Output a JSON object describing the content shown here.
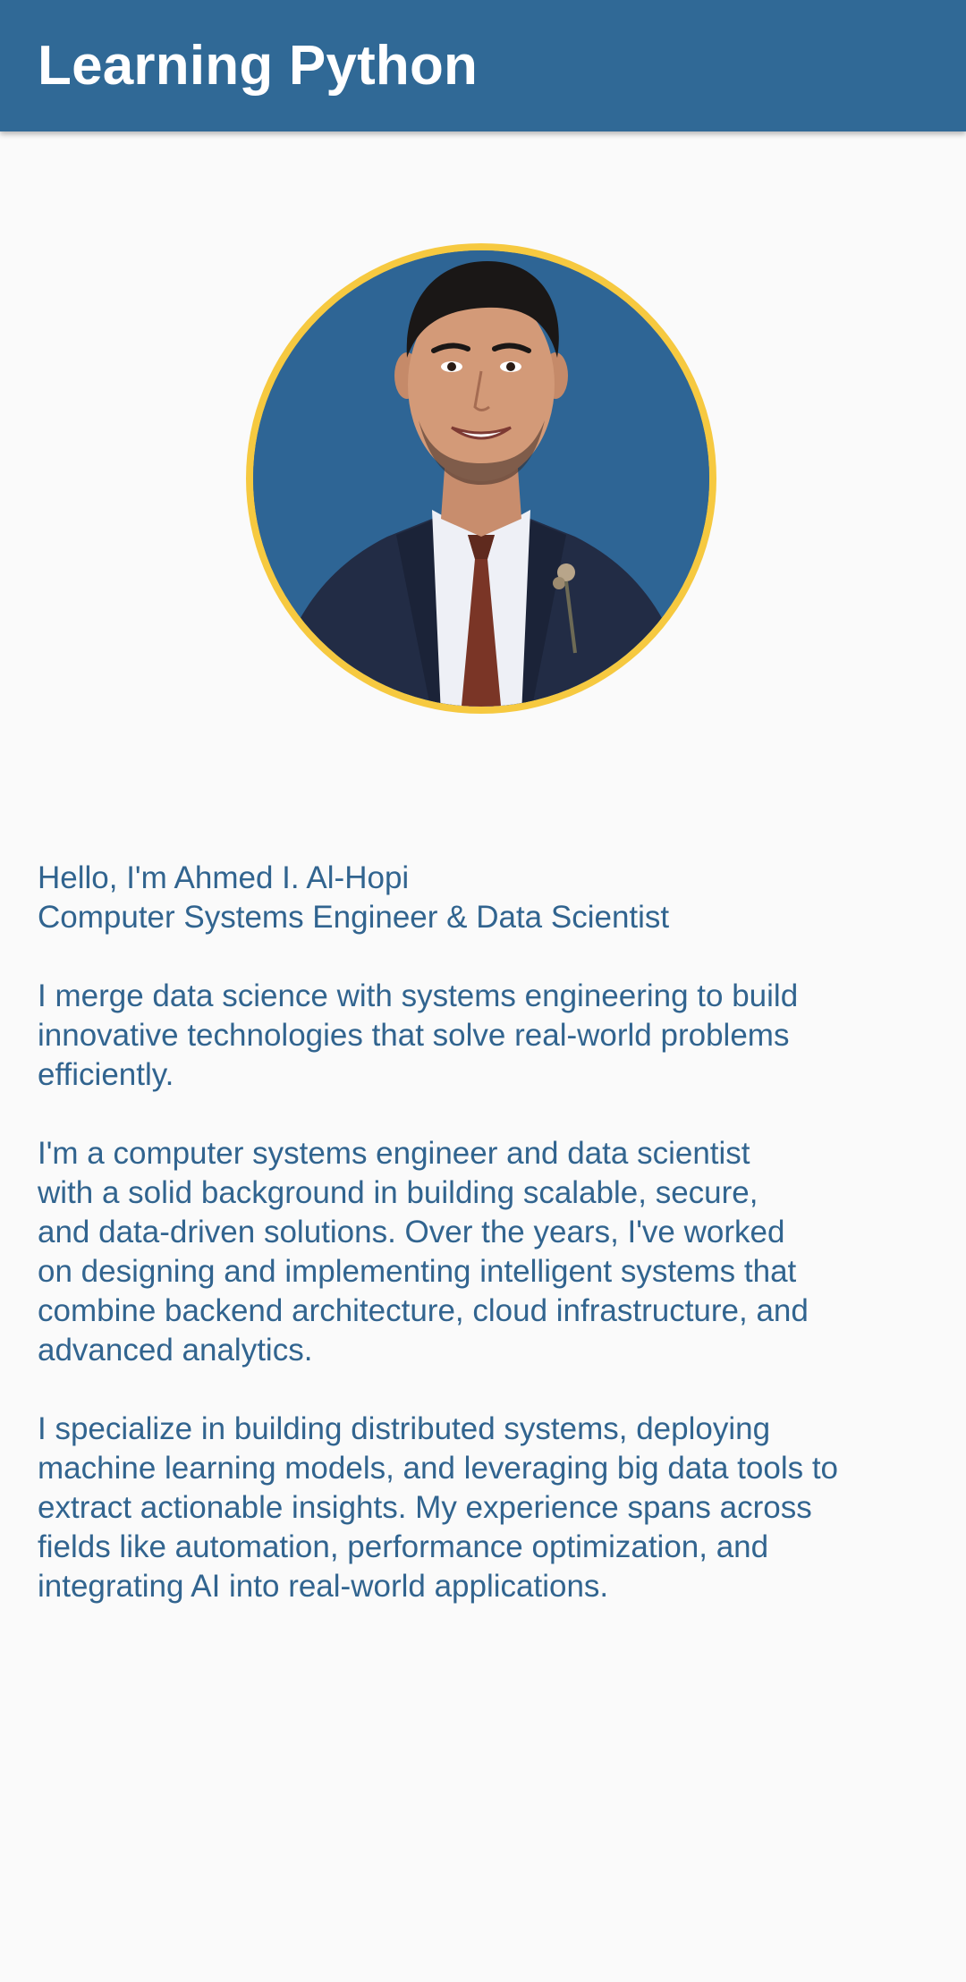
{
  "app_bar": {
    "title": "Learning Python"
  },
  "profile": {
    "avatar": "profile-photo",
    "colors": {
      "app_bar": "#306996",
      "avatar_ring": "#f6c940",
      "avatar_background": "#2e6595",
      "text": "#31648f",
      "page_background": "#fafafa"
    }
  },
  "about": {
    "greeting": "Hello, I'm Ahmed I. Al-Hopi",
    "role": "Computer Systems Engineer & Data Scientist",
    "paragraph_1": "I merge data science with systems engineering to build\ninnovative technologies that solve real-world problems\nefficiently.",
    "paragraph_2": "I'm a computer systems engineer and data scientist\nwith a solid background in building scalable, secure,\nand data-driven solutions. Over the years, I've worked\non designing and implementing intelligent systems that\ncombine backend architecture, cloud infrastructure, and\nadvanced analytics.",
    "paragraph_3": "I specialize in building distributed systems, deploying\nmachine learning models, and leveraging big data tools to\nextract actionable insights. My experience spans across\nfields like automation, performance optimization, and\nintegrating AI into real-world applications."
  }
}
